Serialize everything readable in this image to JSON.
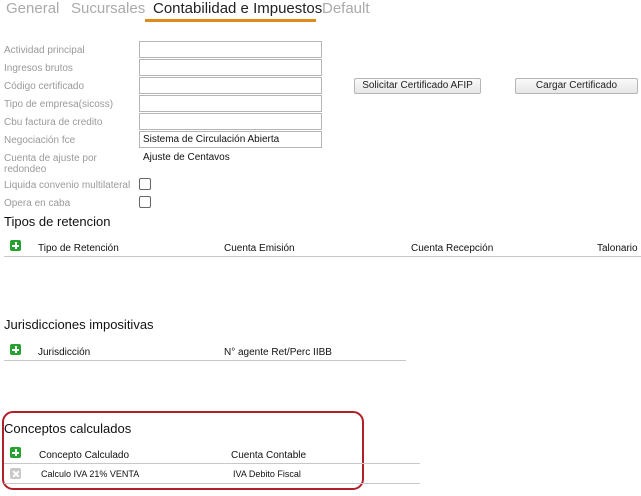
{
  "tabs": [
    "General",
    "Sucursales",
    "Contabilidad e Impuestos",
    "Default"
  ],
  "fields": {
    "actividad_principal": {
      "label": "Actividad principal",
      "value": ""
    },
    "ingresos_brutos": {
      "label": "Ingresos brutos",
      "value": ""
    },
    "codigo_certificado": {
      "label": "Código certificado",
      "value": ""
    },
    "tipo_empresa": {
      "label": "Tipo de empresa(sicoss)",
      "value": ""
    },
    "cbu_factura": {
      "label": "Cbu factura de credito",
      "value": ""
    },
    "negociacion_fce": {
      "label": "Negociación fce",
      "value": "Sistema de Circulación Abierta"
    },
    "cuenta_ajuste": {
      "label": "Cuenta de ajuste por redondeo",
      "value": "Ajuste de Centavos"
    },
    "liquida_convenio": {
      "label": "Liquida convenio multilateral",
      "checked": false
    },
    "opera_caba": {
      "label": "Opera en caba",
      "checked": false
    }
  },
  "buttons": {
    "solicitar": "Solicitar Certificado AFIP",
    "cargar": "Cargar Certificado"
  },
  "retenciones": {
    "title": "Tipos de retencion",
    "columns": [
      "Tipo de Retención",
      "Cuenta Emisión",
      "Cuenta Recepción",
      "Talonario"
    ],
    "rows": []
  },
  "jurisdicciones": {
    "title": "Jurisdicciones impositivas",
    "columns": [
      "Jurisdicción",
      "N° agente Ret/Perc IIBB"
    ],
    "rows": []
  },
  "conceptos": {
    "title": "Conceptos calculados",
    "columns": [
      "Concepto Calculado",
      "Cuenta Contable"
    ],
    "rows": [
      {
        "concepto": "Calculo IVA 21% VENTA",
        "cuenta": "IVA Debito Fiscal"
      }
    ]
  },
  "colors": {
    "accent": "#e08a1a",
    "add": "#27a12f",
    "highlight": "#b0202a"
  }
}
